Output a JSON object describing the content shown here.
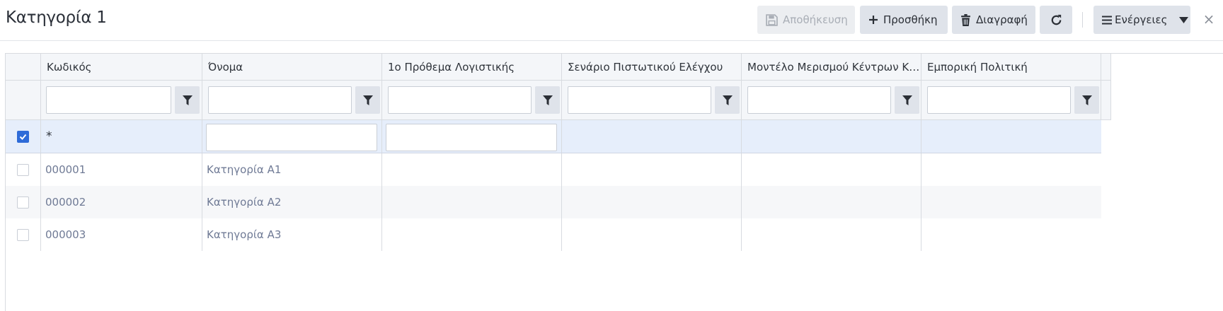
{
  "header": {
    "title": "Κατηγορία 1",
    "buttons": {
      "save": "Αποθήκευση",
      "add": "Προσθήκη",
      "delete": "Διαγραφή",
      "actions": "Ενέργειες"
    },
    "close": "×"
  },
  "grid": {
    "columns": [
      "Κωδικός",
      "Όνομα",
      "1ο Πρόθεμα Λογιστικής",
      "Σενάριο Πιστωτικού Ελέγχου",
      "Μοντέλο Μερισμού Κέντρων Κόστους",
      "Εμπορική Πολιτική"
    ],
    "new_row_marker": "*",
    "rows": [
      {
        "code": "000001",
        "name": "Κατηγορία Α1",
        "checked": false
      },
      {
        "code": "000002",
        "name": "Κατηγορία Α2",
        "checked": false
      },
      {
        "code": "000003",
        "name": "Κατηγορία Α3",
        "checked": false
      }
    ]
  },
  "colors": {
    "accent": "#2e6bd8",
    "button_bg": "#dfe3ea",
    "new_row_bg": "#e6eefb"
  }
}
